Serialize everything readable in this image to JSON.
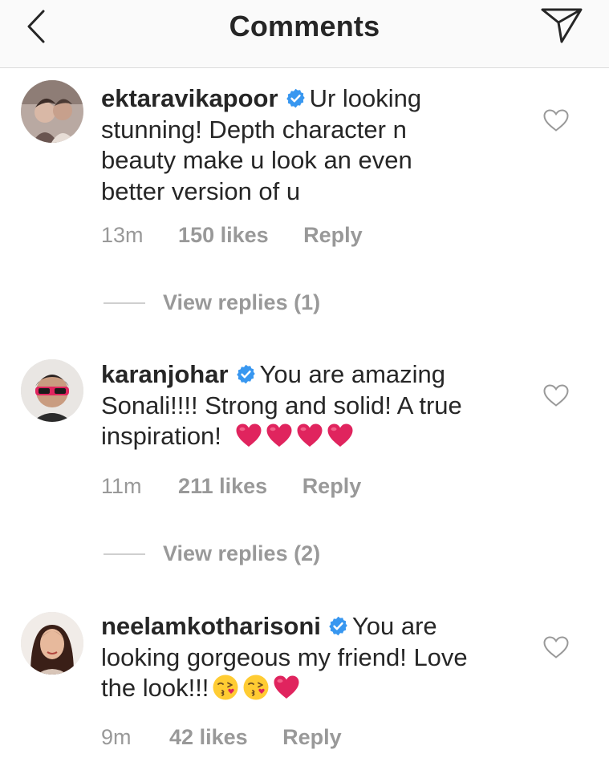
{
  "header": {
    "title": "Comments",
    "back_icon": "chevron-left-icon",
    "send_icon": "paper-plane-icon"
  },
  "colors": {
    "text": "#262626",
    "meta": "#999999",
    "verified": "#3897f0",
    "heart": "#e0245e",
    "divider": "#dbdbdb"
  },
  "comments": [
    {
      "username": "ektaravikapoor",
      "verified": true,
      "text": "Ur looking stunning! Depth character n beauty make u look an even better version of u",
      "time": "13m",
      "likes": "150 likes",
      "reply": "Reply",
      "view_replies": "View replies (1)"
    },
    {
      "username": "karanjohar",
      "verified": true,
      "text": "You are amazing Sonali!!!! Strong and solid! A true inspiration!",
      "emojis": [
        "red-heart",
        "red-heart",
        "red-heart",
        "red-heart"
      ],
      "time": "11m",
      "likes": "211 likes",
      "reply": "Reply",
      "view_replies": "View replies (2)"
    },
    {
      "username": "neelamkotharisoni",
      "verified": true,
      "text": "You are looking gorgeous my friend! Love the look!!!",
      "emojis": [
        "kissing-face",
        "kissing-face",
        "red-heart"
      ],
      "time": "9m",
      "likes": "42 likes",
      "reply": "Reply"
    }
  ]
}
